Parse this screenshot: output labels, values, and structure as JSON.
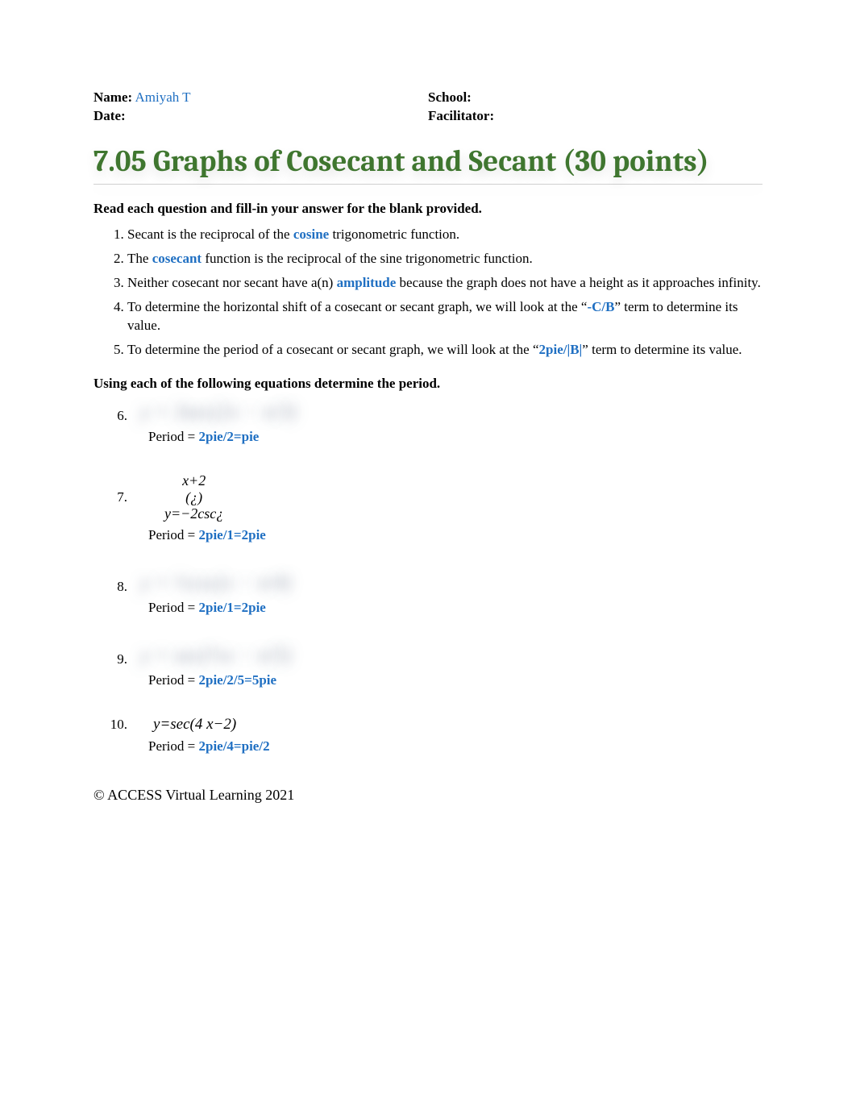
{
  "header": {
    "name_label": "Name:",
    "name_value": "Amiyah T",
    "date_label": "Date:",
    "school_label": "School:",
    "facilitator_label": "Facilitator:"
  },
  "title": "7.05 Graphs of Cosecant and Secant (30 points)",
  "instruction1": "Read each question and fill-in your answer for the blank provided.",
  "fill_in": [
    {
      "pre": "Secant is the reciprocal of the ",
      "answer": "cosine",
      "post": " trigonometric function."
    },
    {
      "pre": "The ",
      "answer": "cosecant",
      "post": " function is the reciprocal of the sine trigonometric function."
    },
    {
      "pre": "Neither cosecant nor secant have a(n) ",
      "answer": "amplitude",
      "post": " because the graph does not have a height as it approaches infinity."
    },
    {
      "pre": "To determine the horizontal shift of a cosecant or secant graph, we will look at the “",
      "answer": "-C/B",
      "post": "” term to determine its value."
    },
    {
      "pre": "To determine the period of a cosecant or secant graph, we will look at the “",
      "answer": "2pie/|B|",
      "post": "” term to determine its value."
    }
  ],
  "instruction2": "Using each of the following equations determine the period.",
  "period_label": "Period = ",
  "questions": {
    "q6": {
      "num": "6.",
      "equation_blur": "y = 3sec(2x − π/3)",
      "answer": "2pie/2=pie"
    },
    "q7": {
      "num": "7.",
      "stack_top": "x+2",
      "stack_mid": "(¿)",
      "stack_bot": "y=−2csc¿",
      "answer": "2pie/1=2pie"
    },
    "q8": {
      "num": "8.",
      "equation_blur": "y = ½csc(x − π/4)",
      "answer": "2pie/1=2pie"
    },
    "q9": {
      "num": "9.",
      "equation_blur": "y = sec(⅔x − π/5)",
      "answer": "2pie/2/5=5pie"
    },
    "q10": {
      "num": "10.",
      "equation": "y=sec(4 x−2)",
      "answer": "2pie/4=pie/2"
    }
  },
  "footer": "© ACCESS Virtual Learning 2021"
}
